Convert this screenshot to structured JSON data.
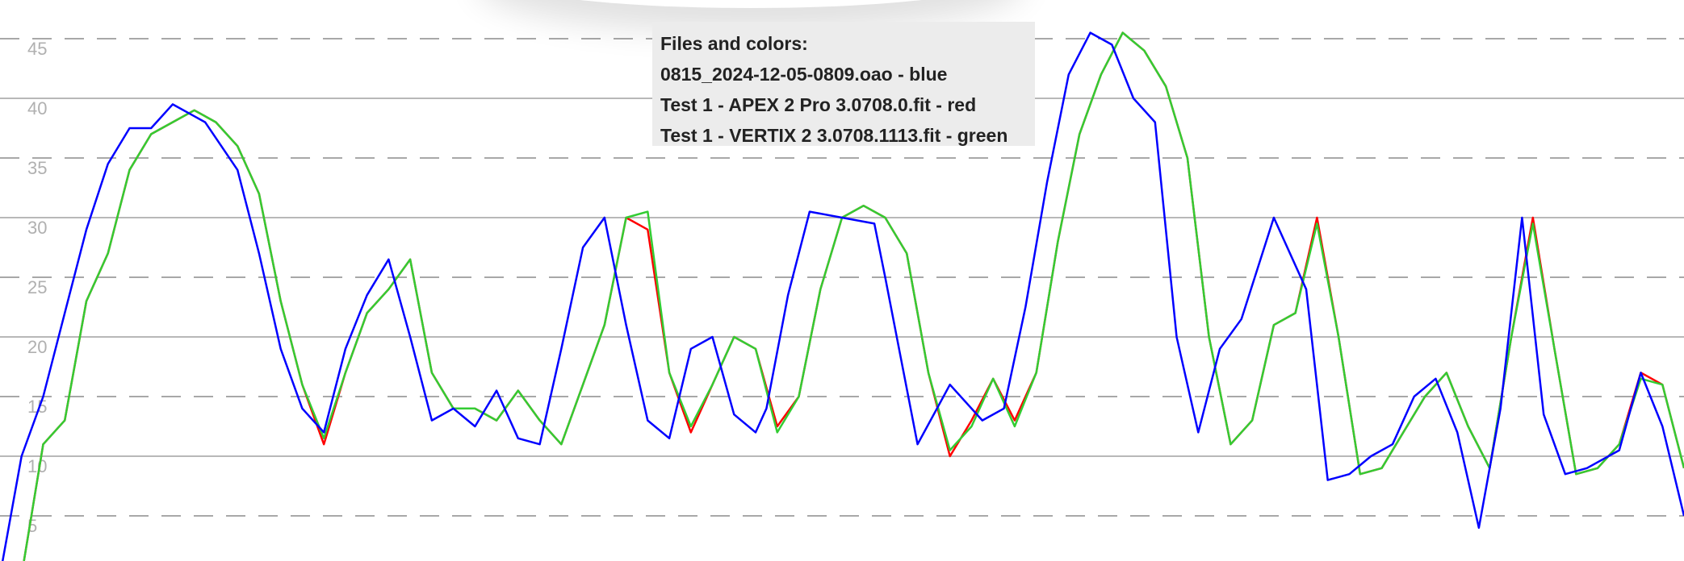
{
  "chart_data": {
    "type": "line",
    "title": "",
    "xlabel": "",
    "ylabel": "",
    "ylim": [
      0,
      47
    ],
    "xlim": [
      0,
      156
    ],
    "y_ticks": [
      "5",
      "10",
      "15",
      "20",
      "25",
      "30",
      "35",
      "40",
      "45"
    ],
    "grid": "horizontal, solid at multiples of 10, dashed at odd multiples of 5",
    "legend": {
      "placement": "top-center",
      "title": "Files and colors:",
      "entries": [
        "0815_2024-12-05-0809.oao - blue",
        "Test 1 - APEX 2 Pro 3.0708.0.fit - red",
        "Test 1 - VERTIX 2 3.0708.1113.fit - green"
      ]
    },
    "series": [
      {
        "color": "#0000ff",
        "x": [
          0,
          2,
          4,
          6,
          8,
          10,
          12,
          14,
          16,
          18,
          19,
          22,
          24,
          26,
          28,
          30,
          32,
          34,
          36,
          38,
          40,
          42,
          44,
          46,
          48,
          50,
          52,
          54,
          56,
          58,
          60,
          62,
          64,
          66,
          68,
          70,
          71,
          73,
          75,
          78,
          81,
          82,
          85,
          88,
          91,
          93,
          95,
          97,
          99,
          101,
          103,
          105,
          107,
          109,
          111,
          113,
          115,
          118,
          121,
          123,
          125,
          127,
          129,
          131,
          133,
          135,
          137,
          139,
          141,
          143,
          145,
          147,
          150,
          152,
          154,
          156
        ],
        "y": [
          0,
          10,
          15,
          22,
          29,
          34.5,
          37.5,
          37.5,
          39.5,
          38.5,
          38,
          34,
          27,
          19,
          14,
          12,
          19,
          23.5,
          26.5,
          20,
          13,
          14,
          12.5,
          15.5,
          11.5,
          11,
          19,
          27.5,
          30,
          21,
          13,
          11.5,
          19,
          20,
          13.5,
          12,
          14,
          23.5,
          30.5,
          30,
          29.5,
          25,
          11,
          16,
          13,
          14,
          22.5,
          33,
          42,
          45.5,
          44.5,
          40,
          38,
          20,
          12,
          19,
          21.5,
          30,
          24,
          8,
          8.5,
          10,
          11,
          15,
          16.5,
          12,
          4,
          14,
          30,
          13.5,
          8.5,
          9,
          10.5,
          17,
          12.5,
          5
        ],
        "name": ""
      },
      {
        "color": "#ff0000",
        "x": [
          0,
          2,
          4,
          6,
          8,
          10,
          12,
          14,
          16,
          18,
          20,
          22,
          24,
          26,
          28,
          30,
          32,
          34,
          36,
          38,
          40,
          42,
          44,
          46,
          48,
          50,
          52,
          54,
          56,
          58,
          60,
          62,
          64,
          66,
          68,
          70,
          72,
          74,
          76,
          78,
          80,
          82,
          84,
          86,
          88,
          90,
          92,
          94,
          96,
          98,
          100,
          102,
          104,
          106,
          108,
          110,
          112,
          114,
          116,
          118,
          120,
          122,
          124,
          126,
          128,
          130,
          132,
          134,
          136,
          138,
          140,
          142,
          144,
          146,
          148,
          150,
          152,
          154,
          156
        ],
        "y": [
          0,
          0,
          11,
          13,
          23,
          27,
          34,
          37,
          38,
          39,
          38,
          36,
          32,
          23,
          16,
          11,
          17,
          22,
          24,
          26.5,
          17,
          14,
          14,
          13,
          15.5,
          13,
          11,
          16,
          21,
          30,
          29,
          17,
          12,
          16,
          20,
          19,
          12.5,
          15,
          24,
          30,
          31,
          30,
          27,
          17,
          10,
          13,
          16.5,
          13,
          17,
          28,
          37,
          42,
          45.5,
          44,
          41,
          35,
          20,
          11,
          13,
          21,
          22,
          30,
          20,
          8.5,
          9,
          12,
          15,
          17,
          12.5,
          9,
          20,
          30,
          19,
          8.5,
          9,
          11,
          17,
          16,
          9
        ],
        "name": ""
      },
      {
        "color": "#33cc33",
        "x": [
          0,
          2,
          4,
          6,
          8,
          10,
          12,
          14,
          16,
          18,
          20,
          22,
          24,
          26,
          28,
          30,
          32,
          34,
          36,
          38,
          40,
          42,
          44,
          46,
          48,
          50,
          52,
          54,
          56,
          58,
          60,
          62,
          64,
          66,
          68,
          70,
          72,
          74,
          76,
          78,
          80,
          82,
          84,
          86,
          88,
          90,
          92,
          94,
          96,
          98,
          100,
          102,
          104,
          106,
          108,
          110,
          112,
          114,
          116,
          118,
          120,
          122,
          124,
          126,
          128,
          130,
          132,
          134,
          136,
          138,
          140,
          142,
          144,
          146,
          148,
          150,
          152,
          154,
          156
        ],
        "y": [
          0,
          0,
          11,
          13,
          23,
          27,
          34,
          37,
          38,
          39,
          38,
          36,
          32,
          23,
          16,
          11.5,
          17,
          22,
          24,
          26.5,
          17,
          14,
          14,
          13,
          15.5,
          13,
          11,
          16,
          21,
          30,
          30.5,
          17,
          12.5,
          16,
          20,
          19,
          12,
          15,
          24,
          30,
          31,
          30,
          27,
          17,
          10.5,
          12.5,
          16.5,
          12.5,
          17,
          28,
          37,
          42,
          45.5,
          44,
          41,
          35,
          20,
          11,
          13,
          21,
          22,
          29.5,
          20,
          8.5,
          9,
          12,
          15,
          17,
          12.5,
          9,
          20,
          29.5,
          19,
          8.5,
          9,
          11,
          16.5,
          16,
          9
        ],
        "name": ""
      }
    ]
  }
}
